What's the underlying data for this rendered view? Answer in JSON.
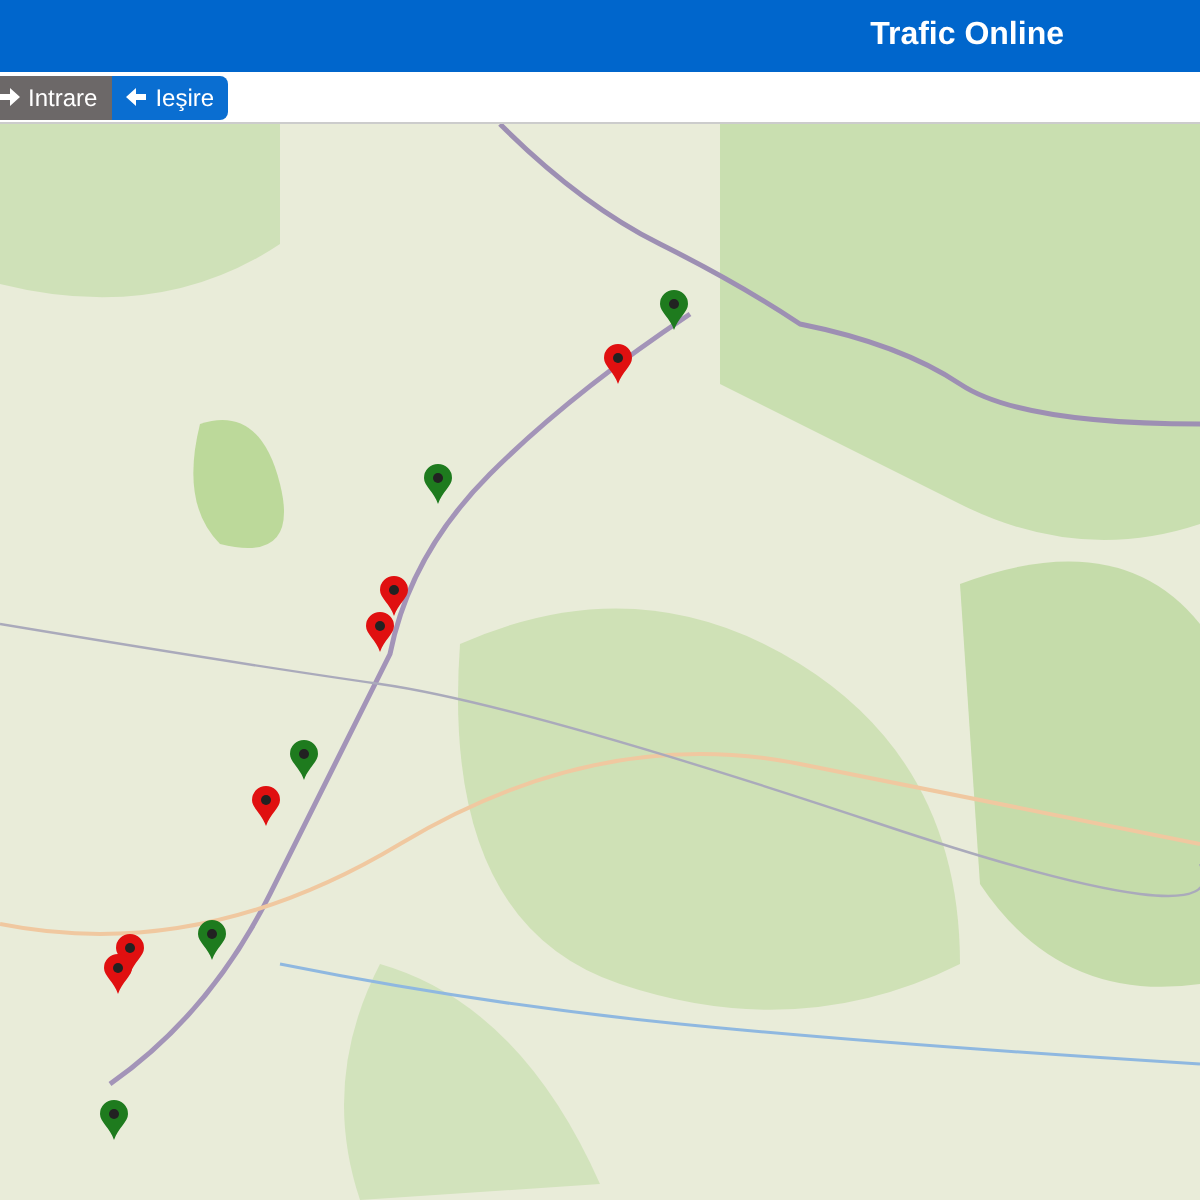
{
  "header": {
    "title": "Trafic Online"
  },
  "toolbar": {
    "buttons": [
      {
        "label": "Intrare",
        "selected": false
      },
      {
        "label": "Ieşire",
        "selected": true
      }
    ]
  },
  "map": {
    "markers": [
      {
        "color": "#1e7b1e"
      },
      {
        "color": "#e01010"
      },
      {
        "color": "#1e7b1e"
      },
      {
        "color": "#e01010"
      },
      {
        "color": "#e01010"
      },
      {
        "color": "#1e7b1e"
      },
      {
        "color": "#e01010"
      },
      {
        "color": "#1e7b1e"
      },
      {
        "color": "#e01010"
      },
      {
        "color": "#e01010"
      },
      {
        "color": "#1e7b1e"
      }
    ]
  }
}
